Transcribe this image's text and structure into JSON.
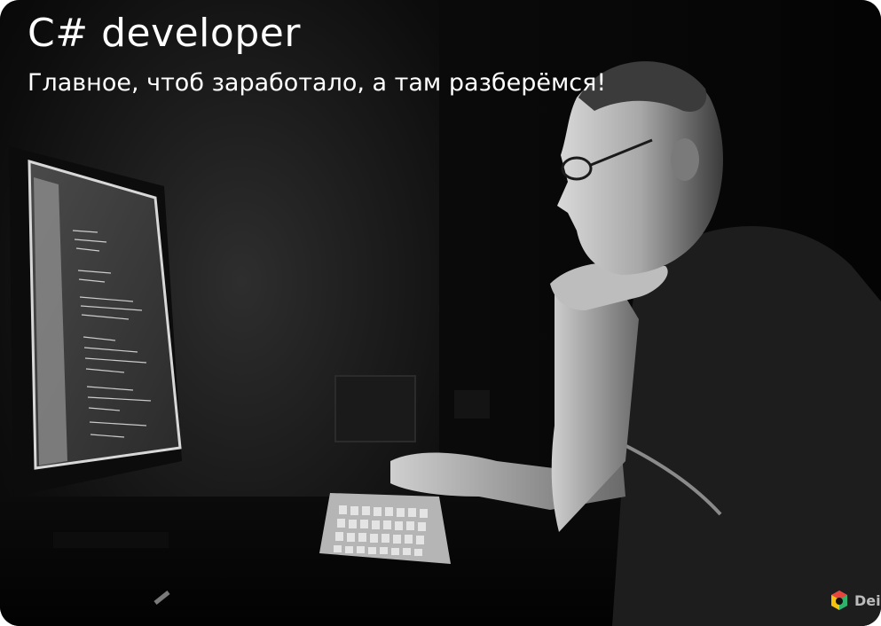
{
  "card": {
    "title": "C# developer",
    "subtitle": "Главное, чтоб заработало, а там разберёмся!"
  },
  "photo": {
    "subject": "programmer-at-monitor",
    "style": "black-and-white"
  },
  "watermark": {
    "text": "Dei",
    "icon": "brand-logo-icon",
    "colors": [
      "#e8453c",
      "#3b8beb",
      "#f4c20d",
      "#2fb36b"
    ]
  }
}
